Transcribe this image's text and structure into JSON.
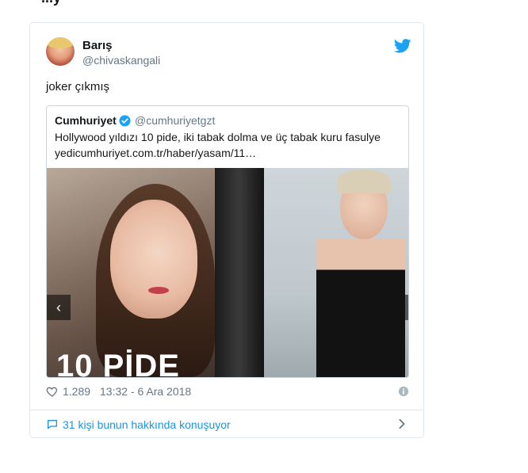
{
  "page_header_partial": "...y",
  "tweet": {
    "author_name": "Barış",
    "author_handle": "@chivaskangali",
    "text": "joker çıkmış",
    "likes": "1.289",
    "timestamp": "13:32 - 6 Ara 2018",
    "conversation_text": "31 kişi bunun hakkında konuşuyor"
  },
  "quoted_tweet": {
    "author_name": "Cumhuriyet",
    "author_handle": "@cumhuriyetgzt",
    "text": "Hollywood yıldızı 10 pide, iki tabak dolma ve üç tabak kuru fasulye",
    "link": "yedicumhuriyet.com.tr/haber/yasam/11…",
    "media_caption": "10 PİDE"
  },
  "icons": {
    "brand": "twitter-bird-icon",
    "verified": "verified-check-icon",
    "like": "heart-outline-icon",
    "info": "info-circle-icon",
    "conversation": "speech-bubble-icon",
    "next": "chevron-right-icon",
    "prev": "chevron-left-icon"
  },
  "colors": {
    "twitter_blue": "#1da1f2",
    "link_blue": "#1b95e0",
    "text_dark": "#14171a",
    "text_muted": "#657786",
    "border": "#e1e8ed"
  }
}
